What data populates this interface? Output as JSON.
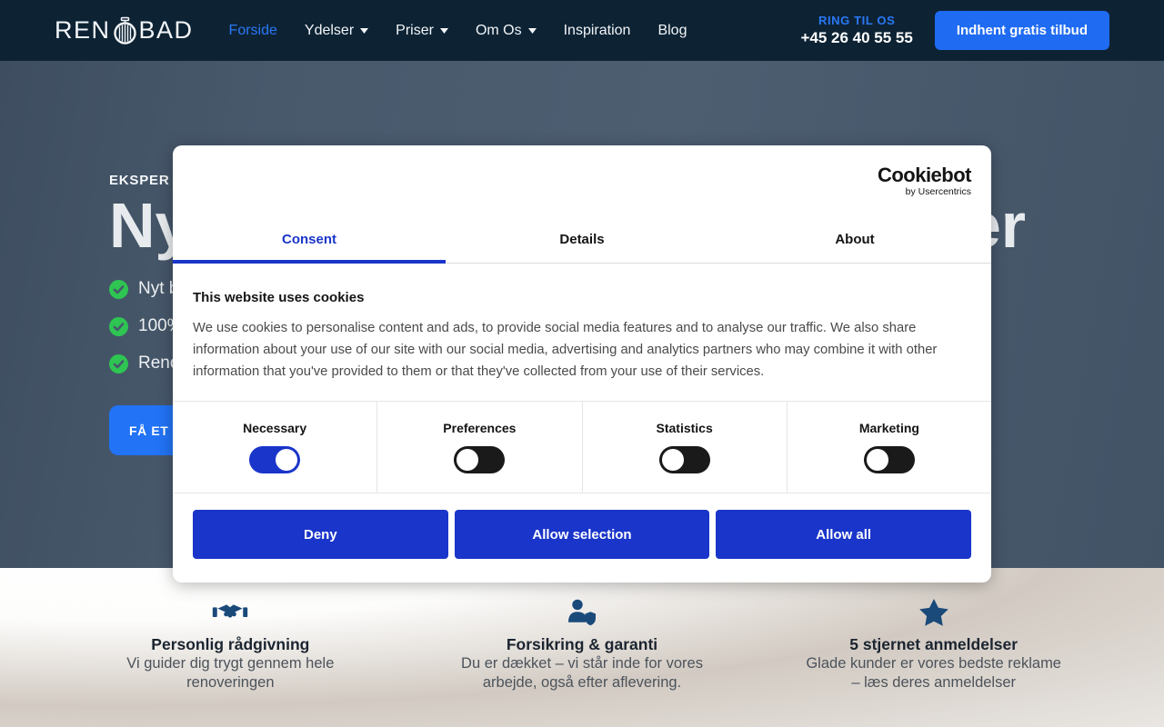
{
  "nav": {
    "logo_left": "REN",
    "logo_right": "BAD",
    "items": [
      {
        "label": "Forside",
        "active": true,
        "caret": false
      },
      {
        "label": "Ydelser",
        "active": false,
        "caret": true
      },
      {
        "label": "Priser",
        "active": false,
        "caret": true
      },
      {
        "label": "Om Os",
        "active": false,
        "caret": true
      },
      {
        "label": "Inspiration",
        "active": false,
        "caret": false
      },
      {
        "label": "Blog",
        "active": false,
        "caret": false
      }
    ],
    "call_label": "RING TIL OS",
    "phone": "+45 26 40 55 55",
    "cta_label": "Indhent gratis tilbud"
  },
  "hero": {
    "eyebrow_visible": "EKSPER",
    "heading_visible_start": "Ny",
    "heading_visible_end": "er",
    "checklist_visible": [
      {
        "text": "Nyt b"
      },
      {
        "text": "100%"
      },
      {
        "text": "Reno"
      }
    ],
    "cta_visible": "FÅ ET"
  },
  "cookie_dialog": {
    "brand": "Cookiebot",
    "brand_byline": "by Usercentrics",
    "tabs": [
      {
        "label": "Consent",
        "active": true
      },
      {
        "label": "Details",
        "active": false
      },
      {
        "label": "About",
        "active": false
      }
    ],
    "heading": "This website uses cookies",
    "description": "We use cookies to personalise content and ads, to provide social media features and to analyse our traffic. We also share information about your use of our site with our social media, advertising and analytics partners who may combine it with other information that you've provided to them or that they've collected from your use of their services.",
    "categories": [
      {
        "label": "Necessary",
        "enabled": true
      },
      {
        "label": "Preferences",
        "enabled": false
      },
      {
        "label": "Statistics",
        "enabled": false
      },
      {
        "label": "Marketing",
        "enabled": false
      }
    ],
    "buttons": [
      {
        "label": "Deny"
      },
      {
        "label": "Allow selection"
      },
      {
        "label": "Allow all"
      }
    ]
  },
  "features": [
    {
      "icon": "handshake-icon",
      "title": "Personlig rådgivning",
      "line1": "Vi guider dig trygt gennem hele",
      "line2": "renoveringen"
    },
    {
      "icon": "user-shield-icon",
      "title": "Forsikring & garanti",
      "line1": "Du er dækket – vi står inde for vores",
      "line2": "arbejde, også efter aflevering."
    },
    {
      "icon": "star-icon",
      "title": "5 stjernet anmeldelser",
      "line1": "Glade kunder er vores bedste reklame",
      "line2": "– læs deres anmeldelser"
    }
  ],
  "colors": {
    "nav_bg": "#0D2334",
    "hero_bg": "#47586B",
    "accent_bright_blue": "#2A78F6",
    "cta_blue": "#1F6BF2",
    "dialog_royal_blue": "#1A35C9",
    "toggle_off": "#1A1A1A",
    "success_green": "#2EC552",
    "feature_icon_navy": "#1A4A7A"
  }
}
